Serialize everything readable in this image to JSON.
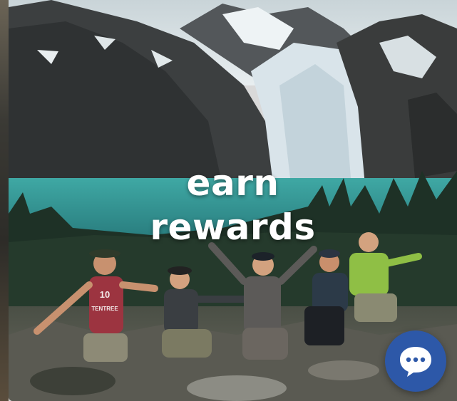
{
  "hero": {
    "headline_line1": "earn",
    "headline_line2": "rewards",
    "shirt_logo_number": "10",
    "shirt_logo_text": "TENTREE"
  },
  "chat_widget": {
    "icon": "chat-bubble-icon",
    "accent_color": "#2d58a8"
  }
}
